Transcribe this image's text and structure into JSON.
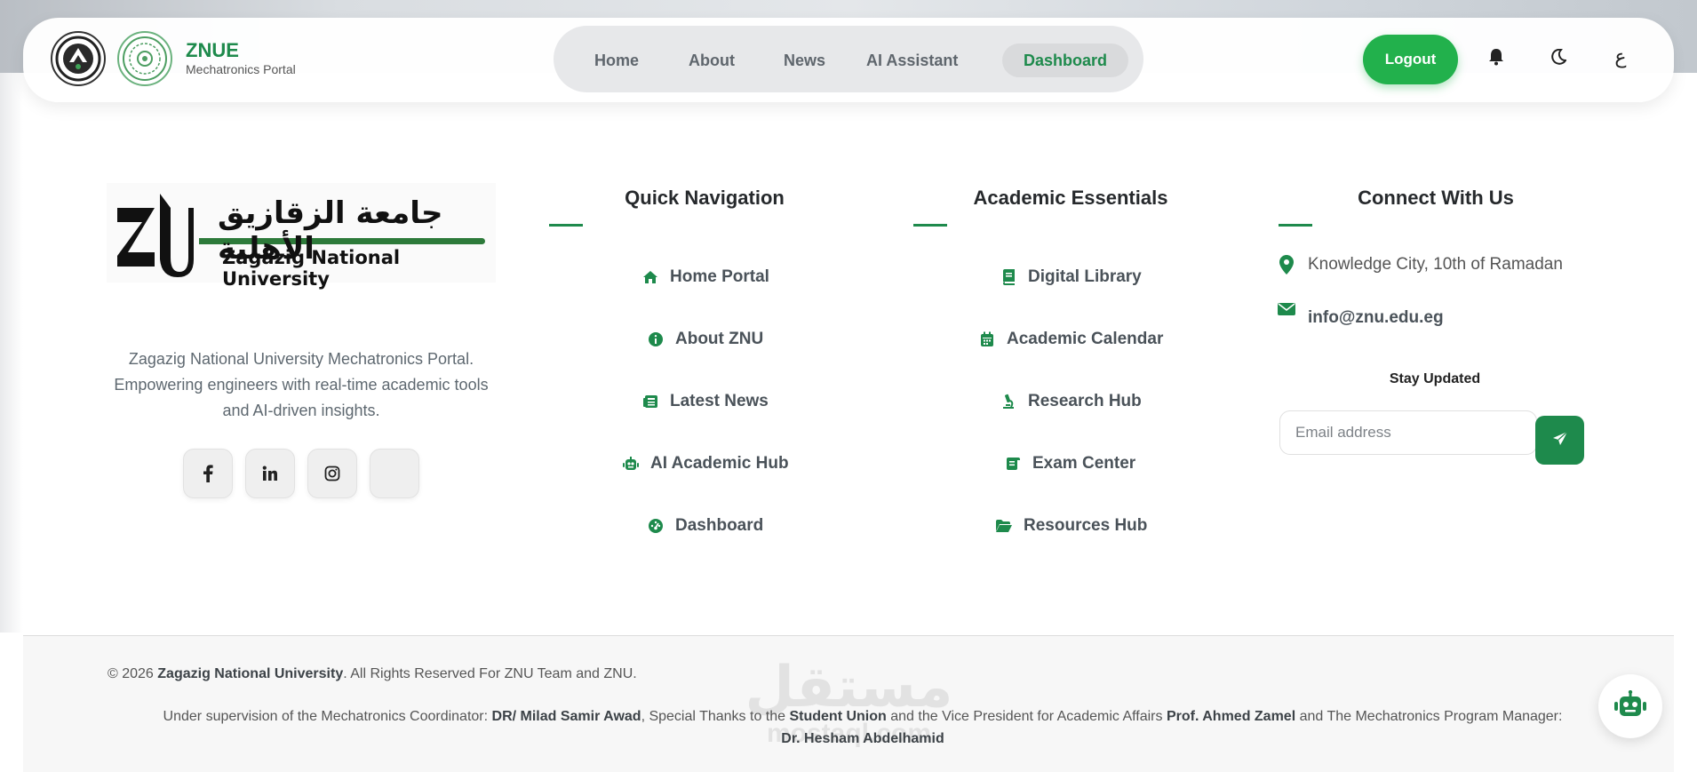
{
  "header": {
    "brand_title": "ZNUE",
    "brand_subtitle": "Mechatronics Portal",
    "nav": [
      {
        "label": "Home",
        "active": false
      },
      {
        "label": "About",
        "active": false
      },
      {
        "label": "News",
        "active": false
      },
      {
        "label": "AI Assistant",
        "active": false
      },
      {
        "label": "Dashboard",
        "active": true
      }
    ],
    "logout_label": "Logout",
    "language_toggle": "ع",
    "icons": [
      "bell-icon",
      "moon-icon"
    ]
  },
  "footer": {
    "logo": {
      "arabic_text": "جامعة الزقازيق الأهلية",
      "english_text": "Zagazig National University"
    },
    "about_text": "Zagazig National University Mechatronics Portal. Empowering engineers with real-time academic tools and AI-driven insights.",
    "social": [
      {
        "name": "facebook-icon",
        "glyph": "f"
      },
      {
        "name": "linkedin-icon",
        "glyph": "in"
      },
      {
        "name": "instagram-icon",
        "glyph": ""
      },
      {
        "name": "blank-social-icon",
        "glyph": ""
      }
    ],
    "quick_navigation": {
      "title": "Quick Navigation",
      "links": [
        {
          "label": "Home Portal",
          "icon": "home-icon"
        },
        {
          "label": "About ZNU",
          "icon": "info-icon"
        },
        {
          "label": "Latest News",
          "icon": "newspaper-icon"
        },
        {
          "label": "AI Academic Hub",
          "icon": "robot-icon"
        },
        {
          "label": "Dashboard",
          "icon": "gauge-icon"
        }
      ]
    },
    "academic_essentials": {
      "title": "Academic Essentials",
      "links": [
        {
          "label": "Digital Library",
          "icon": "book-icon"
        },
        {
          "label": "Academic Calendar",
          "icon": "calendar-icon"
        },
        {
          "label": "Research Hub",
          "icon": "microscope-icon"
        },
        {
          "label": "Exam Center",
          "icon": "scroll-icon"
        },
        {
          "label": "Resources Hub",
          "icon": "folder-open-icon"
        }
      ]
    },
    "connect": {
      "title": "Connect With Us",
      "address": "Knowledge City, 10th of Ramadan",
      "email": "info@znu.edu.eg",
      "stay_updated": "Stay Updated",
      "email_placeholder": "Email address"
    },
    "colors": {
      "accent": "#1e8a4c",
      "logout": "#22b14c"
    }
  },
  "bottom": {
    "copyright_prefix": "© 2026 ",
    "copyright_org": "Zagazig National University",
    "copyright_suffix": ". All Rights Reserved For ZNU Team and ZNU.",
    "credits": {
      "part1": "Under supervision of the Mechatronics Coordinator: ",
      "name1": "DR/ Milad Samir Awad",
      "part2": ", Special Thanks to the ",
      "name2": "Student Union",
      "part3": " and the Vice President for Academic Affairs ",
      "name3": "Prof. Ahmed Zamel",
      "part4": " and The Mechatronics Program Manager: ",
      "name4": "Dr. Hesham Abdelhamid"
    },
    "watermark_ar": "مستقل",
    "watermark_en": "mostaql.com"
  }
}
